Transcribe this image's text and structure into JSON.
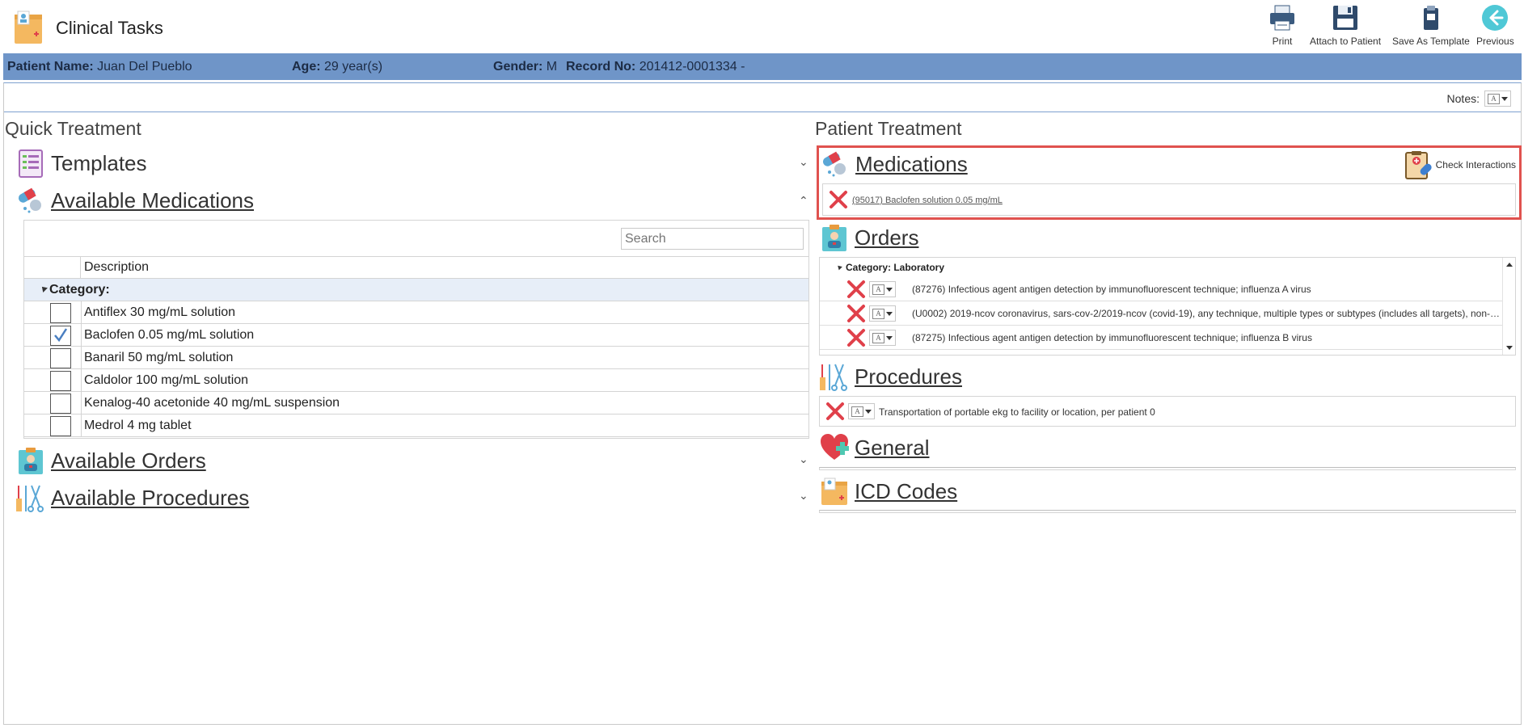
{
  "app": {
    "title": "Clinical Tasks"
  },
  "toolbar": {
    "print": "Print",
    "attach": "Attach to Patient",
    "save_template": "Save As Template",
    "previous": "Previous"
  },
  "patient": {
    "name_label": "Patient Name:",
    "name": "Juan Del Pueblo",
    "age_label": "Age:",
    "age": "29 year(s)",
    "gender_label": "Gender:",
    "gender": "M",
    "record_label": "Record No:",
    "record": "201412-0001334 -"
  },
  "notes": {
    "label": "Notes:"
  },
  "quick_treatment": {
    "title": "Quick Treatment",
    "sections": {
      "templates": "Templates",
      "available_medications": "Available Medications",
      "available_orders": "Available Orders",
      "available_procedures": "Available Procedures"
    },
    "grid": {
      "search_placeholder": "Search",
      "column_description": "Description",
      "category_label": "Category:",
      "rows": [
        {
          "label": "Antiflex 30 mg/mL solution",
          "checked": false
        },
        {
          "label": "Baclofen 0.05 mg/mL solution",
          "checked": true
        },
        {
          "label": "Banaril 50 mg/mL solution",
          "checked": false
        },
        {
          "label": "Caldolor 100 mg/mL solution",
          "checked": false
        },
        {
          "label": "Kenalog-40 acetonide 40 mg/mL suspension",
          "checked": false
        },
        {
          "label": "Medrol 4 mg tablet",
          "checked": false
        }
      ]
    }
  },
  "patient_treatment": {
    "title": "Patient Treatment",
    "medications": {
      "title": "Medications",
      "check_interactions": "Check Interactions",
      "items": [
        "(95017) Baclofen solution 0.05 mg/mL"
      ]
    },
    "orders": {
      "title": "Orders",
      "category_label": "Category: Laboratory",
      "items": [
        "(87276) Infectious agent antigen detection by immunofluorescent technique; influenza A virus",
        "(U0002) 2019-ncov coronavirus, sars-cov-2/2019-ncov (covid-19), any technique, multiple types or subtypes (includes all targets), non-c...",
        "(87275) Infectious agent antigen detection by immunofluorescent technique; influenza B virus"
      ]
    },
    "procedures": {
      "title": "Procedures",
      "items": [
        "Transportation of portable ekg to facility or location, per patient 0"
      ]
    },
    "general": {
      "title": "General"
    },
    "icd_codes": {
      "title": "ICD Codes"
    }
  },
  "colors": {
    "patient_bar": "#6f95c8",
    "highlight_border": "#e0524f",
    "remove_icon": "#e0404a",
    "check_tick": "#4a7fc1"
  },
  "icons": {
    "toolbar": [
      "printer-icon",
      "floppy-disk-icon",
      "clipboard-save-icon",
      "back-arrow-icon"
    ],
    "sections": [
      "templates-icon",
      "pills-icon",
      "orders-icon",
      "procedures-icon",
      "heart-plus-icon",
      "folder-icon"
    ]
  }
}
